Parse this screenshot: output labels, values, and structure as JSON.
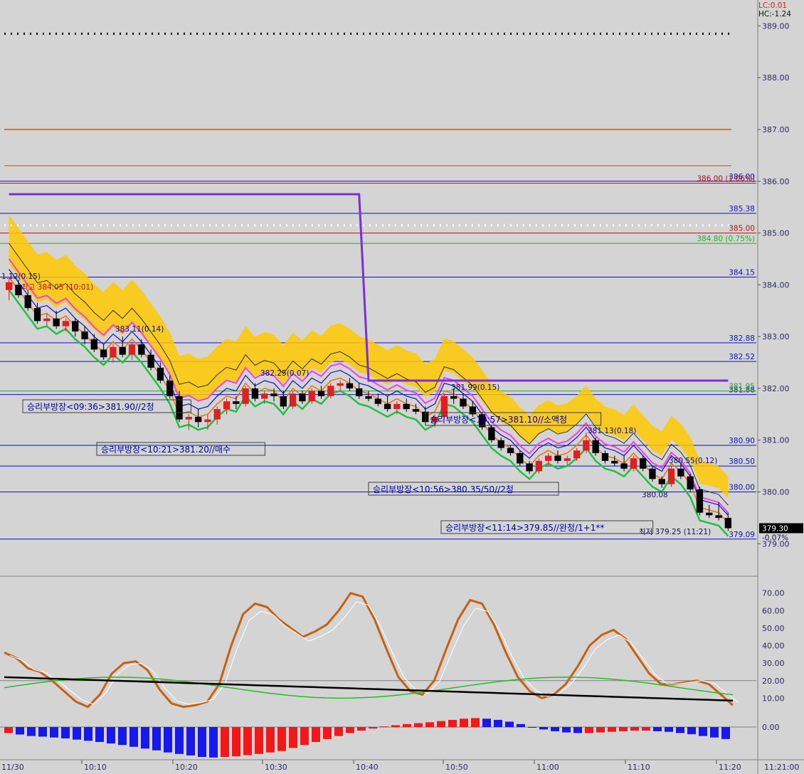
{
  "header": {
    "lc": "LC:0.01",
    "hc": "HC:-1.24"
  },
  "colors": {
    "background": "#d4d4d4",
    "up_candle": "#e02020",
    "down_candle": "#000000",
    "cloud_yellow": "#ffc800",
    "cloud_cyan": "#40c8f8",
    "purple_line": "#7a30d8",
    "green_line": "#20c040",
    "orange_line": "#f07010"
  },
  "chart_data": {
    "type": "candlestick",
    "price_axis": {
      "ylim": [
        378.4,
        389.5
      ],
      "ticks": [
        "389.00",
        "388.00",
        "387.00",
        "386.00",
        "385.00",
        "384.00",
        "383.00",
        "382.00",
        "381.00",
        "380.00",
        "379.00"
      ]
    },
    "time_axis": {
      "labels": [
        "11/30",
        "10:10",
        "10:20",
        "10:30",
        "10:40",
        "10:50",
        "11:00",
        "11:10",
        "11:20",
        "11:21:00"
      ],
      "start_minute": 0
    },
    "candles": [
      {
        "o": 383.9,
        "h": 384.15,
        "l": 383.7,
        "c": 384.05
      },
      {
        "o": 384.0,
        "h": 384.1,
        "l": 383.75,
        "c": 383.8
      },
      {
        "o": 383.8,
        "h": 383.9,
        "l": 383.5,
        "c": 383.55
      },
      {
        "o": 383.55,
        "h": 383.65,
        "l": 383.25,
        "c": 383.3
      },
      {
        "o": 383.3,
        "h": 383.45,
        "l": 383.2,
        "c": 383.35
      },
      {
        "o": 383.35,
        "h": 383.5,
        "l": 383.15,
        "c": 383.2
      },
      {
        "o": 383.2,
        "h": 383.35,
        "l": 383.1,
        "c": 383.3
      },
      {
        "o": 383.3,
        "h": 383.35,
        "l": 383.0,
        "c": 383.1
      },
      {
        "o": 383.1,
        "h": 383.2,
        "l": 382.85,
        "c": 382.95
      },
      {
        "o": 382.95,
        "h": 383.05,
        "l": 382.7,
        "c": 382.75
      },
      {
        "o": 382.75,
        "h": 382.85,
        "l": 382.55,
        "c": 382.6
      },
      {
        "o": 382.6,
        "h": 382.85,
        "l": 382.5,
        "c": 382.8
      },
      {
        "o": 382.8,
        "h": 383.0,
        "l": 382.6,
        "c": 382.65
      },
      {
        "o": 382.65,
        "h": 382.9,
        "l": 382.55,
        "c": 382.85
      },
      {
        "o": 382.85,
        "h": 382.95,
        "l": 382.6,
        "c": 382.65
      },
      {
        "o": 382.65,
        "h": 382.75,
        "l": 382.35,
        "c": 382.4
      },
      {
        "o": 382.4,
        "h": 382.5,
        "l": 382.1,
        "c": 382.15
      },
      {
        "o": 382.15,
        "h": 382.25,
        "l": 381.8,
        "c": 381.85
      },
      {
        "o": 381.85,
        "h": 381.95,
        "l": 381.35,
        "c": 381.4
      },
      {
        "o": 381.4,
        "h": 381.5,
        "l": 381.2,
        "c": 381.45
      },
      {
        "o": 381.45,
        "h": 381.6,
        "l": 381.25,
        "c": 381.35
      },
      {
        "o": 381.35,
        "h": 381.5,
        "l": 381.2,
        "c": 381.4
      },
      {
        "o": 381.4,
        "h": 381.65,
        "l": 381.3,
        "c": 381.6
      },
      {
        "o": 381.6,
        "h": 381.8,
        "l": 381.5,
        "c": 381.75
      },
      {
        "o": 381.75,
        "h": 381.85,
        "l": 381.6,
        "c": 381.7
      },
      {
        "o": 381.7,
        "h": 382.05,
        "l": 381.65,
        "c": 382.0
      },
      {
        "o": 382.0,
        "h": 382.1,
        "l": 381.75,
        "c": 381.8
      },
      {
        "o": 381.8,
        "h": 381.95,
        "l": 381.7,
        "c": 381.9
      },
      {
        "o": 381.9,
        "h": 382.0,
        "l": 381.75,
        "c": 381.85
      },
      {
        "o": 381.85,
        "h": 381.95,
        "l": 381.6,
        "c": 381.65
      },
      {
        "o": 381.65,
        "h": 381.95,
        "l": 381.6,
        "c": 381.9
      },
      {
        "o": 381.9,
        "h": 381.95,
        "l": 381.7,
        "c": 381.75
      },
      {
        "o": 381.75,
        "h": 382.0,
        "l": 381.7,
        "c": 381.95
      },
      {
        "o": 381.95,
        "h": 382.05,
        "l": 381.8,
        "c": 381.85
      },
      {
        "o": 381.85,
        "h": 382.1,
        "l": 381.8,
        "c": 382.05
      },
      {
        "o": 382.05,
        "h": 382.15,
        "l": 381.95,
        "c": 382.1
      },
      {
        "o": 382.1,
        "h": 382.2,
        "l": 381.95,
        "c": 382.0
      },
      {
        "o": 382.0,
        "h": 382.1,
        "l": 381.8,
        "c": 381.85
      },
      {
        "o": 381.85,
        "h": 381.95,
        "l": 381.75,
        "c": 381.8
      },
      {
        "o": 381.8,
        "h": 381.9,
        "l": 381.65,
        "c": 381.7
      },
      {
        "o": 381.7,
        "h": 381.85,
        "l": 381.55,
        "c": 381.6
      },
      {
        "o": 381.6,
        "h": 381.75,
        "l": 381.5,
        "c": 381.7
      },
      {
        "o": 381.7,
        "h": 381.8,
        "l": 381.55,
        "c": 381.6
      },
      {
        "o": 381.6,
        "h": 381.7,
        "l": 381.5,
        "c": 381.55
      },
      {
        "o": 381.55,
        "h": 381.65,
        "l": 381.3,
        "c": 381.35
      },
      {
        "o": 381.35,
        "h": 381.5,
        "l": 381.25,
        "c": 381.45
      },
      {
        "o": 381.45,
        "h": 381.9,
        "l": 381.4,
        "c": 381.85
      },
      {
        "o": 381.85,
        "h": 382.0,
        "l": 381.7,
        "c": 381.8
      },
      {
        "o": 381.8,
        "h": 381.9,
        "l": 381.6,
        "c": 381.65
      },
      {
        "o": 381.65,
        "h": 381.75,
        "l": 381.45,
        "c": 381.5
      },
      {
        "o": 381.5,
        "h": 381.55,
        "l": 381.2,
        "c": 381.25
      },
      {
        "o": 381.25,
        "h": 381.3,
        "l": 380.95,
        "c": 381.0
      },
      {
        "o": 381.0,
        "h": 381.05,
        "l": 380.8,
        "c": 380.85
      },
      {
        "o": 380.85,
        "h": 380.9,
        "l": 380.7,
        "c": 380.75
      },
      {
        "o": 380.75,
        "h": 380.8,
        "l": 380.5,
        "c": 380.55
      },
      {
        "o": 380.55,
        "h": 380.6,
        "l": 380.35,
        "c": 380.4
      },
      {
        "o": 380.4,
        "h": 380.65,
        "l": 380.35,
        "c": 380.6
      },
      {
        "o": 380.6,
        "h": 380.75,
        "l": 380.5,
        "c": 380.7
      },
      {
        "o": 380.7,
        "h": 380.8,
        "l": 380.55,
        "c": 380.6
      },
      {
        "o": 380.6,
        "h": 380.7,
        "l": 380.5,
        "c": 380.65
      },
      {
        "o": 380.65,
        "h": 380.85,
        "l": 380.6,
        "c": 380.8
      },
      {
        "o": 380.8,
        "h": 381.15,
        "l": 380.75,
        "c": 381.0
      },
      {
        "o": 381.0,
        "h": 381.05,
        "l": 380.7,
        "c": 380.75
      },
      {
        "o": 380.75,
        "h": 380.8,
        "l": 380.55,
        "c": 380.6
      },
      {
        "o": 380.6,
        "h": 380.7,
        "l": 380.5,
        "c": 380.55
      },
      {
        "o": 380.55,
        "h": 380.7,
        "l": 380.4,
        "c": 380.45
      },
      {
        "o": 380.45,
        "h": 380.7,
        "l": 380.4,
        "c": 380.65
      },
      {
        "o": 380.65,
        "h": 380.7,
        "l": 380.4,
        "c": 380.45
      },
      {
        "o": 380.45,
        "h": 380.5,
        "l": 380.2,
        "c": 380.25
      },
      {
        "o": 380.25,
        "h": 380.3,
        "l": 380.08,
        "c": 380.15
      },
      {
        "o": 380.15,
        "h": 380.5,
        "l": 380.1,
        "c": 380.45
      },
      {
        "o": 380.45,
        "h": 380.55,
        "l": 380.25,
        "c": 380.3
      },
      {
        "o": 380.3,
        "h": 380.35,
        "l": 380.0,
        "c": 380.05
      },
      {
        "o": 380.05,
        "h": 380.1,
        "l": 379.55,
        "c": 379.6
      },
      {
        "o": 379.6,
        "h": 379.75,
        "l": 379.5,
        "c": 379.55
      },
      {
        "o": 379.55,
        "h": 379.8,
        "l": 379.45,
        "c": 379.5
      },
      {
        "o": 379.5,
        "h": 379.6,
        "l": 379.25,
        "c": 379.3
      }
    ],
    "horizontal_levels": [
      {
        "price": 386.0,
        "label": "386.00",
        "color": "#1010c0"
      },
      {
        "price": 385.96,
        "label": "386.00 (1.06%)",
        "color": "#c01010"
      },
      {
        "price": 385.38,
        "label": "385.38",
        "color": "#1010c0"
      },
      {
        "price": 385.0,
        "label": "385.00",
        "color": "#c01010"
      },
      {
        "price": 384.8,
        "label": "384.80 (0.75%)",
        "color": "#20b020"
      },
      {
        "price": 384.15,
        "label": "384.15",
        "color": "#1010c0"
      },
      {
        "price": 382.88,
        "label": "382.88",
        "color": "#1010c0"
      },
      {
        "price": 382.52,
        "label": "382.52",
        "color": "#1010c0"
      },
      {
        "price": 381.88,
        "label": "381.88",
        "color": "#1010c0"
      },
      {
        "price": 381.95,
        "label": "381.95",
        "color": "#20b020"
      },
      {
        "price": 380.9,
        "label": "380.90",
        "color": "#1010c0"
      },
      {
        "price": 380.5,
        "label": "380.50",
        "color": "#1010c0"
      },
      {
        "price": 380.0,
        "label": "380.00",
        "color": "#1010c0"
      },
      {
        "price": 379.09,
        "label": "379.09",
        "color": "#1010c0"
      }
    ],
    "annotations": [
      {
        "text": "승리부방장<09:36>381.90//2청"
      },
      {
        "text": "승리부방장<10:21>381.20//매수"
      },
      {
        "text": "승리부방장<10:57>381.10//소액청"
      },
      {
        "text": "승리부방장<10:56>380.35/50//2청"
      },
      {
        "text": "승리부방장<11:14>379.85//완청/1+1**"
      }
    ],
    "price_notes": [
      {
        "text": "1.12(0.15)"
      },
      {
        "text": "최고 384.05 (10:01)"
      },
      {
        "text": "383.11(0.14)"
      },
      {
        "text": "382.25(0.07)"
      },
      {
        "text": "381.99(0.15)"
      },
      {
        "text": "381.13(0.18)"
      },
      {
        "text": "380.55(0.12)"
      },
      {
        "text": "380.08"
      },
      {
        "text": "최저 379.25 (11:21)"
      }
    ],
    "current_price": {
      "value": "379.30",
      "change": "-0.07%"
    },
    "oscillator": {
      "ylim": [
        0,
        78
      ],
      "ticks": [
        "70.00",
        "60.00",
        "50.00",
        "40.00",
        "30.00",
        "20.00",
        "10.00"
      ],
      "orange": [
        36,
        33,
        27,
        25,
        20,
        14,
        8,
        5,
        12,
        24,
        30,
        31,
        26,
        15,
        7,
        5,
        6,
        8,
        18,
        40,
        58,
        64,
        62,
        55,
        50,
        45,
        48,
        52,
        60,
        70,
        68,
        55,
        38,
        22,
        14,
        12,
        20,
        38,
        55,
        66,
        64,
        52,
        36,
        22,
        14,
        10,
        12,
        18,
        28,
        40,
        46,
        49,
        44,
        34,
        24,
        18,
        18,
        19,
        20,
        18,
        12,
        6
      ]
    },
    "histogram": {
      "zero_label": "0.00",
      "values": [
        -0.2,
        -0.25,
        -0.3,
        -0.32,
        -0.35,
        -0.38,
        -0.42,
        -0.46,
        -0.5,
        -0.55,
        -0.6,
        -0.66,
        -0.72,
        -0.78,
        -0.85,
        -0.9,
        -0.95,
        -1.0,
        -1.02,
        -1.0,
        -0.98,
        -0.94,
        -0.9,
        -0.85,
        -0.8,
        -0.7,
        -0.6,
        -0.5,
        -0.4,
        -0.3,
        -0.2,
        -0.12,
        -0.05,
        0.02,
        0.06,
        0.1,
        0.13,
        0.16,
        0.2,
        0.24,
        0.28,
        0.3,
        0.28,
        0.24,
        0.18,
        0.1,
        0.0,
        -0.08,
        -0.14,
        -0.18,
        -0.2,
        -0.2,
        -0.18,
        -0.16,
        -0.14,
        -0.12,
        -0.12,
        -0.14,
        -0.16,
        -0.2,
        -0.24,
        -0.3,
        -0.35,
        -0.4
      ]
    }
  }
}
